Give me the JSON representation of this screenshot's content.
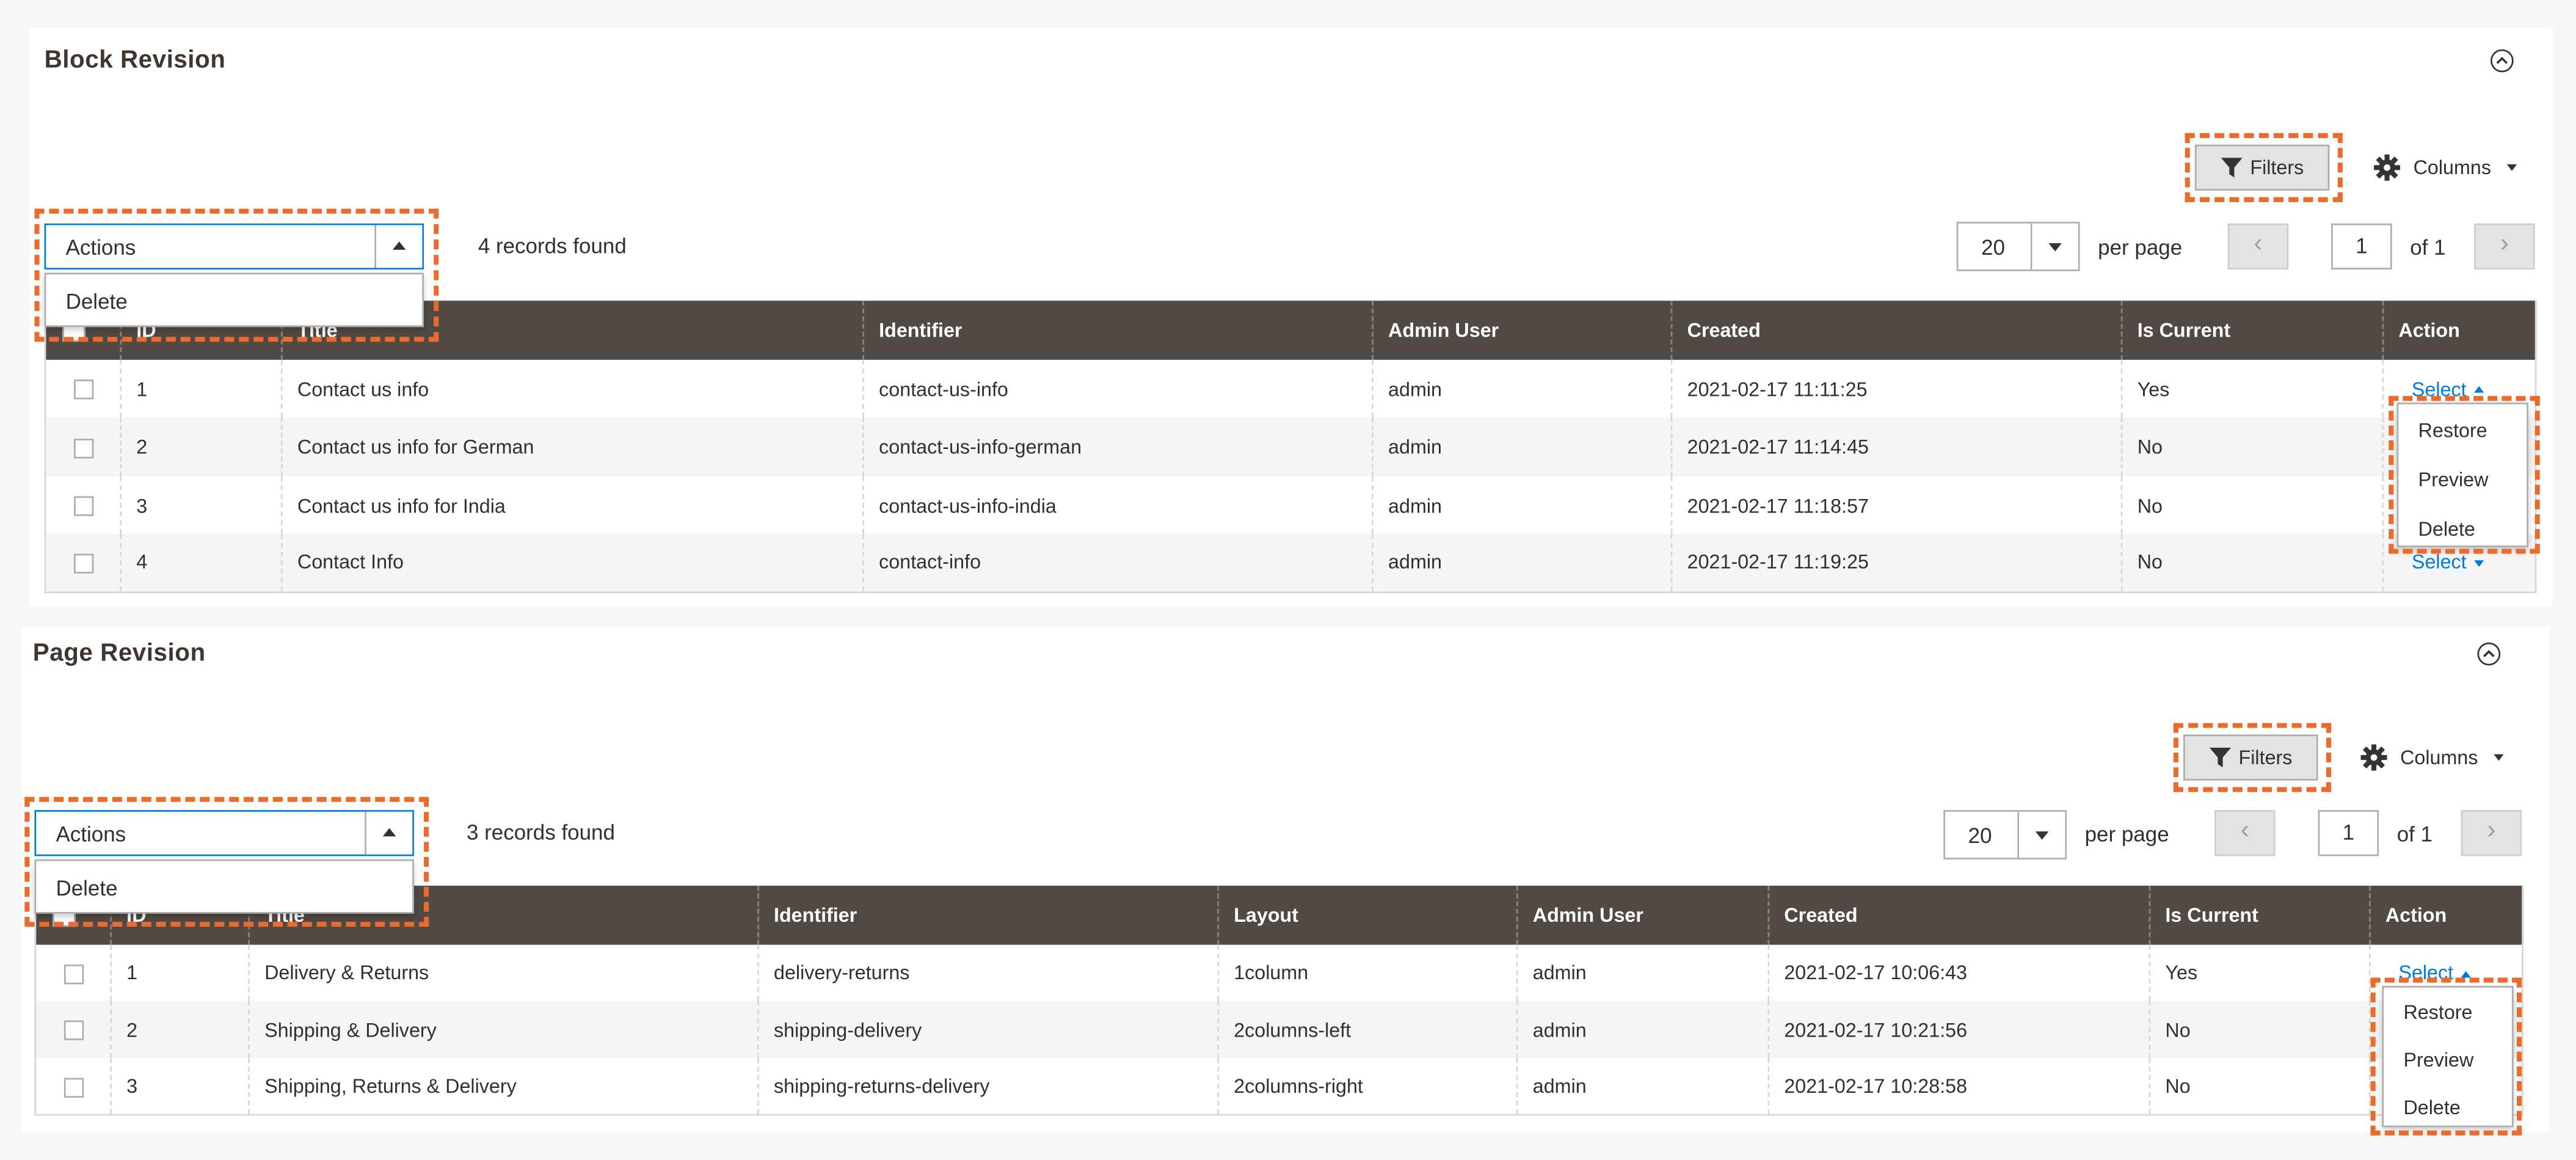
{
  "sections": {
    "block": {
      "title": "Block Revision",
      "filters_label": "Filters",
      "columns_label": "Columns",
      "actions_label": "Actions",
      "actions_menu": [
        "Delete"
      ],
      "records_found": "4 records found",
      "per_page_value": "20",
      "per_page_label": "per page",
      "page_current": "1",
      "page_of": "of 1",
      "headers": [
        "ID",
        "Title",
        "Identifier",
        "Admin User",
        "Created",
        "Is Current",
        "Action"
      ],
      "rows": [
        {
          "id": "1",
          "title": "Contact us info",
          "identifier": "contact-us-info",
          "admin": "admin",
          "created": "2021-02-17 11:11:25",
          "current": "Yes",
          "action": "Select"
        },
        {
          "id": "2",
          "title": "Contact us info for German",
          "identifier": "contact-us-info-german",
          "admin": "admin",
          "created": "2021-02-17 11:14:45",
          "current": "No",
          "action": "Select"
        },
        {
          "id": "3",
          "title": "Contact us info for India",
          "identifier": "contact-us-info-india",
          "admin": "admin",
          "created": "2021-02-17 11:18:57",
          "current": "No",
          "action": "Select"
        },
        {
          "id": "4",
          "title": "Contact Info",
          "identifier": "contact-info",
          "admin": "admin",
          "created": "2021-02-17 11:19:25",
          "current": "No",
          "action": "Select"
        }
      ],
      "row_menu": [
        "Restore",
        "Preview",
        "Delete"
      ]
    },
    "page": {
      "title": "Page Revision",
      "filters_label": "Filters",
      "columns_label": "Columns",
      "actions_label": "Actions",
      "actions_menu": [
        "Delete"
      ],
      "records_found": "3 records found",
      "per_page_value": "20",
      "per_page_label": "per page",
      "page_current": "1",
      "page_of": "of 1",
      "headers": [
        "ID",
        "Title",
        "Identifier",
        "Layout",
        "Admin User",
        "Created",
        "Is Current",
        "Action"
      ],
      "rows": [
        {
          "id": "1",
          "title": "Delivery & Returns",
          "identifier": "delivery-returns",
          "layout": "1column",
          "admin": "admin",
          "created": "2021-02-17 10:06:43",
          "current": "Yes",
          "action": "Select"
        },
        {
          "id": "2",
          "title": "Shipping & Delivery",
          "identifier": "shipping-delivery",
          "layout": "2columns-left",
          "admin": "admin",
          "created": "2021-02-17 10:21:56",
          "current": "No",
          "action": "Select"
        },
        {
          "id": "3",
          "title": "Shipping, Returns & Delivery",
          "identifier": "shipping-returns-delivery",
          "layout": "2columns-right",
          "admin": "admin",
          "created": "2021-02-17 10:28:58",
          "current": "No",
          "action": "Select"
        }
      ],
      "row_menu": [
        "Restore",
        "Preview",
        "Delete"
      ]
    }
  },
  "colors": {
    "header_bg": "#514943",
    "link": "#007bdb",
    "highlight": "#eb6b2d"
  }
}
